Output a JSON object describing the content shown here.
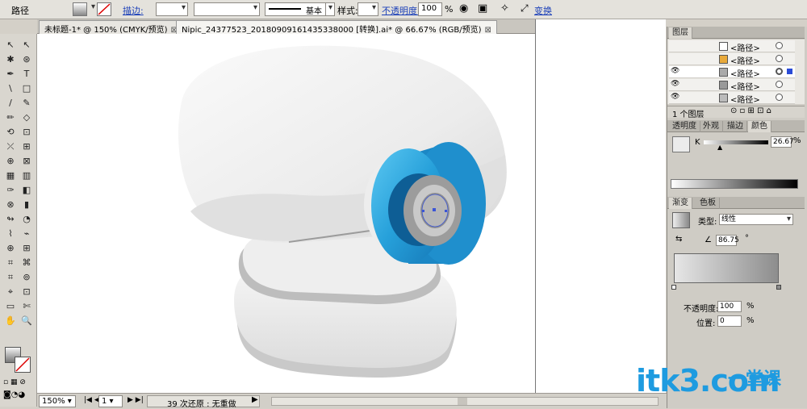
{
  "control_bar": {
    "object_type": "路径",
    "stroke_link": "描边:",
    "stroke_profile": "基本",
    "style_label": "样式:",
    "opacity_link": "不透明度:",
    "opacity_value": "100",
    "opacity_unit": "%",
    "transform_link": "变换"
  },
  "tabs": [
    {
      "label": "未标题-1* @ 150% (CMYK/预览)"
    },
    {
      "label": "Nipic_24377523_20180909161435338000 [转换].ai* @ 66.67% (RGB/预览)"
    }
  ],
  "tools": [
    "↖",
    "↖",
    "✱",
    "⊛",
    "✒",
    "T",
    "\\",
    "□",
    "/",
    "✎",
    "✏",
    "◇",
    "⟲",
    "⊡",
    "⤫",
    "⊞",
    "⊕",
    "⊠",
    "▦",
    "▥",
    "✑",
    "◧",
    "⊗",
    "▮",
    "↬",
    "◔",
    "⌇",
    "⌁",
    "⊕",
    "⊞",
    "⌗",
    "⌘",
    "⌗",
    "⊚",
    "⌖",
    "⊡",
    "▭",
    "✄",
    "✋",
    "🔍"
  ],
  "status": {
    "zoom": "150%",
    "page": "1",
    "undo_text": "39 次还原 : 无重做"
  },
  "layers": {
    "title": "图层",
    "rows": [
      {
        "name": "<路径>"
      },
      {
        "name": "<路径>"
      },
      {
        "name": "<路径>"
      },
      {
        "name": "<路径>"
      },
      {
        "name": "<路径>"
      }
    ],
    "footer": "1 个图层"
  },
  "color_panel": {
    "tabs": [
      "透明度",
      "外观",
      "描边",
      "颜色"
    ],
    "channel": "K",
    "value": "26.67",
    "unit": "%"
  },
  "gradient_panel": {
    "tabs": [
      "渐变",
      "色板"
    ],
    "type_label": "类型:",
    "type_value": "线性",
    "angle": "86.75",
    "angle_unit": "°",
    "opacity_label": "不透明度:",
    "opacity_value": "100",
    "location_label": "位置:",
    "location_value": "0",
    "unit": "%"
  },
  "watermark": {
    "text": "itk3.com",
    "cn": "一堂课"
  },
  "colors": {
    "accent_blue": "#1e9be0",
    "lens_blue": "#2aa5dc",
    "link_blue": "#1a3fb8"
  }
}
